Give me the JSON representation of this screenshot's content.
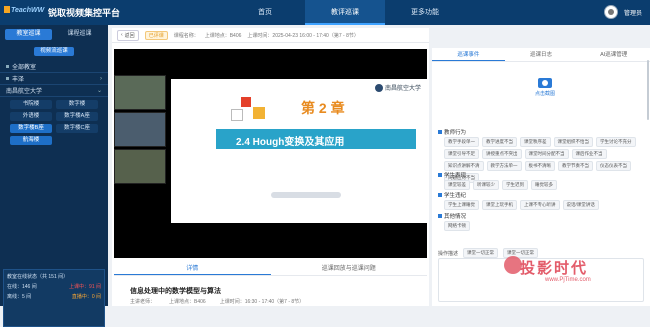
{
  "app": {
    "logo": "TeachWW",
    "platform": "锐取视频集控平台"
  },
  "nav": [
    {
      "label": "首页"
    },
    {
      "label": "教评巡课"
    },
    {
      "label": "更多功能"
    }
  ],
  "user": {
    "name": "管理员"
  },
  "sidebar": {
    "tabs": [
      {
        "label": "教室巡课"
      },
      {
        "label": "课程巡课"
      }
    ],
    "sub_tab": "视频流巡课",
    "rows": [
      {
        "label": "全部教室"
      },
      {
        "label": "丰泽"
      },
      {
        "label": "南昌航空大学"
      }
    ],
    "rooms": [
      "书院楼",
      "数字楼",
      "外语楼",
      "数字楼A座",
      "数字楼B座",
      "数字楼C座",
      "航海楼"
    ],
    "stats": {
      "title": "教室在线状态（共 151 间）",
      "online": "在线：146 间",
      "offline": "离线：5 间",
      "recording": "上课中：91 间",
      "live": "直播中：0 间"
    }
  },
  "breadcrumb": {
    "back": "返回",
    "badge": "已评课",
    "teacher": "课程名称：",
    "location": "上课地点：B406",
    "time": "上课时间：2025-04-23 16:00 - 17:40（第7 - 8节）"
  },
  "slide": {
    "chapter": "第 2 章",
    "title": "2.4 Hough变换及其应用",
    "school": "南昌航空大学"
  },
  "video_tabs": [
    {
      "label": "详情"
    },
    {
      "label": "巡课回放与巡课问题"
    }
  ],
  "info": {
    "title": "信息处理中的数学模型与算法",
    "teacher": "主讲老师：",
    "location": "上课地点：B406",
    "time": "上课时间：16:30 - 17:40（第7 - 8节）"
  },
  "right": {
    "tabs": [
      {
        "label": "巡课事件"
      },
      {
        "label": "巡课日志"
      },
      {
        "label": "AI巡课管理"
      }
    ],
    "shot_label": "点击截图",
    "sections": [
      {
        "title": "教师行为",
        "tags": [
          "教学手段单一",
          "教学进度不当",
          "课堂秩序差",
          "课堂组织不恰当",
          "学生讨论不充分",
          "课堂引导不足",
          "讲授重点不突出",
          "课堂时间分配不当",
          "课后作业不当",
          "知识点讲解不清",
          "教学方法单一",
          "板书不清晰",
          "教学节奏不当",
          "仪态仪表不当",
          "问题应对不当"
        ]
      },
      {
        "title": "学生表现",
        "tags": [
          "课堂较差",
          "听课较少",
          "学生迟到",
          "睡觉较多"
        ]
      },
      {
        "title": "学生违纪",
        "tags": [
          "学生上课睡觉",
          "课堂上玩手机",
          "上课不专心听讲",
          "说话/课堂讲话"
        ]
      },
      {
        "title": "其他情况",
        "tags": [
          "网络卡顿"
        ]
      }
    ],
    "ops_label": "操作描述",
    "ops_tags": [
      "课堂一切正常",
      "课堂一切正常"
    ]
  },
  "watermark": {
    "text": "投影时代",
    "url": "www.PjTime.com"
  },
  "colors": {
    "topbar": "#0b3d6e",
    "sidebar": "#0e2f52",
    "accent": "#2a7ad6",
    "chapter": "#e88b20",
    "slide_bar": "#29a3c9"
  }
}
